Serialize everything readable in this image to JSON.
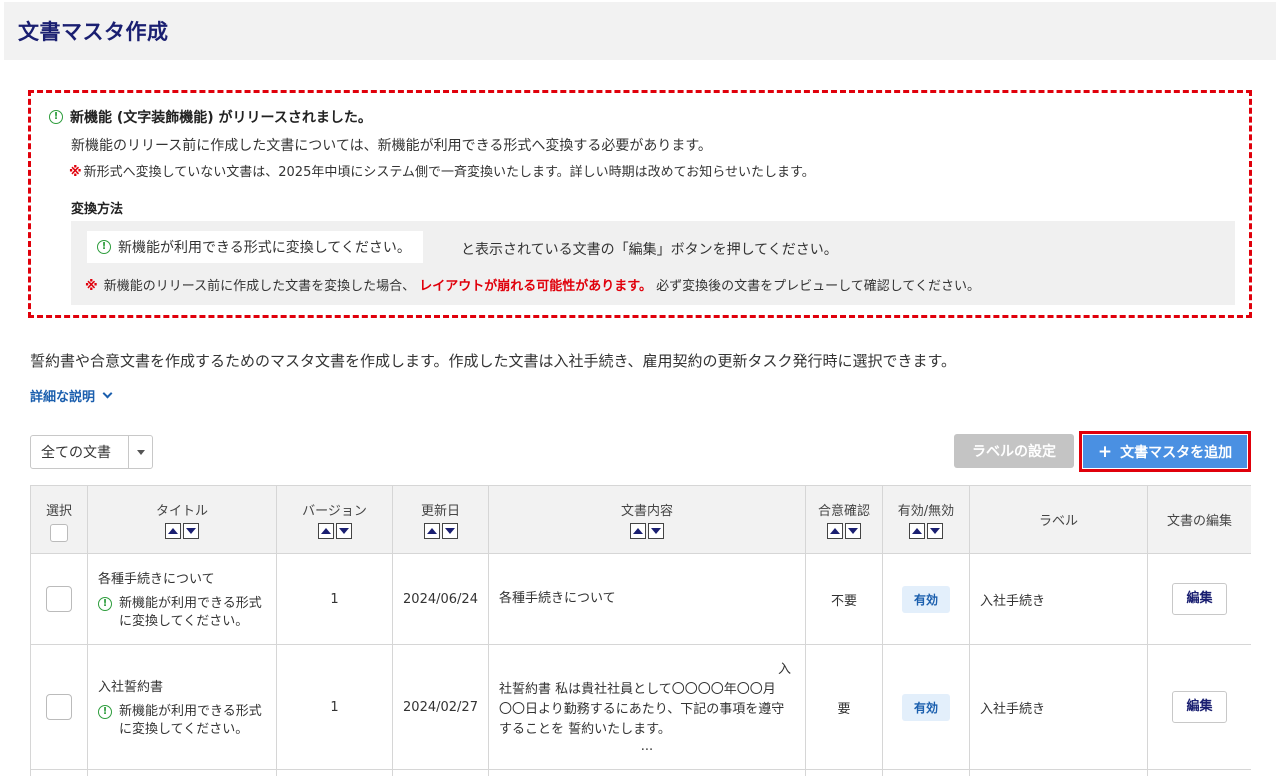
{
  "page": {
    "title": "文書マスタ作成"
  },
  "notice": {
    "headline": "新機能 (文字装飾機能) がリリースされました。",
    "line1": "新機能のリリース前に作成した文書については、新機能が利用できる形式へ変換する必要があります。",
    "line2_mark": "※",
    "line2": "新形式へ変換していない文書は、2025年中頃にシステム側で一斉変換いたします。詳しい時期は改めてお知らせいたします。",
    "method_title": "変換方法",
    "method_chip": "新機能が利用できる形式に変換してください。",
    "method_text": "と表示されている文書の「編集」ボタンを押してください。",
    "caution_mark": "※",
    "caution_pre": "新機能のリリース前に作成した文書を変換した場合、",
    "caution_red": "レイアウトが崩れる可能性があります。",
    "caution_post": "必ず変換後の文書をプレビューして確認してください。"
  },
  "description": "誓約書や合意文書を作成するためのマスタ文書を作成します。作成した文書は入社手続き、雇用契約の更新タスク発行時に選択できます。",
  "detail_link": "詳細な説明",
  "filter": {
    "selected": "全ての文書"
  },
  "buttons": {
    "label_setting": "ラベルの設定",
    "add_plus": "+",
    "add_master": "文書マスタを追加"
  },
  "table": {
    "headers": {
      "select": "選択",
      "title": "タイトル",
      "version": "バージョン",
      "updated": "更新日",
      "content": "文書内容",
      "consent": "合意確認",
      "status": "有効/無効",
      "label": "ラベル",
      "edit": "文書の編集"
    },
    "rows": [
      {
        "title": "各種手続きについて",
        "note_line1": "新機能が利用できる形式",
        "note_line2": "に変換してください。",
        "version": "1",
        "updated": "2024/06/24",
        "content": "各種手続きについて",
        "consent": "不要",
        "status": "有効",
        "label": "入社手続き",
        "edit": "編集"
      },
      {
        "title": "入社誓約書",
        "note_line1": "新機能が利用できる形式",
        "note_line2": "に変換してください。",
        "version": "1",
        "updated": "2024/02/27",
        "content_first": "入",
        "content_l1": "社誓約書 私は貴社社員として〇〇〇〇年〇〇月",
        "content_l2": "〇〇日より勤務するにあたり、下記の事項を遵守",
        "content_l3": "することを 誓約いたします。",
        "content_ellipsis": "...",
        "consent": "要",
        "status": "有効",
        "label": "入社手続き",
        "edit": "編集"
      }
    ]
  },
  "colors": {
    "title": "#1a1f71",
    "accent": "#4a90e2",
    "alert": "#e0000b",
    "info_icon": "#2e9d3d",
    "link": "#1b5fae"
  }
}
